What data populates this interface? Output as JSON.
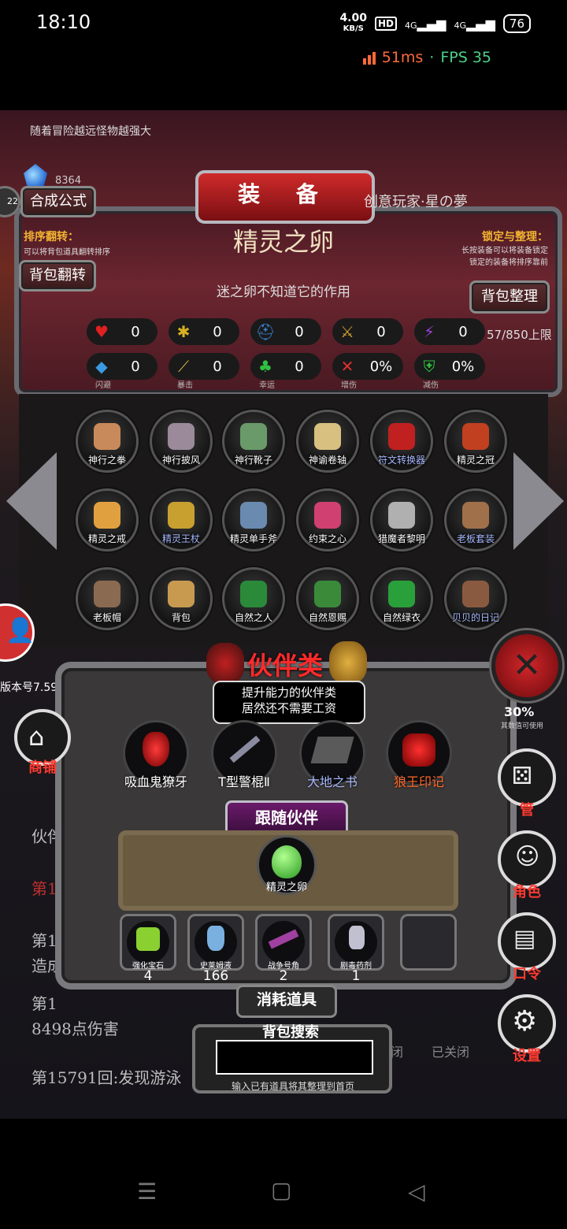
{
  "status": {
    "time": "18:10",
    "net_speed": "4.00",
    "net_unit": "KB/S",
    "hd": "HD",
    "sig1": "4G",
    "sig2": "4G",
    "battery": "76",
    "ping": "51ms",
    "fps": "FPS 35",
    "sep": "·"
  },
  "game": {
    "tip": "随着冒险越远怪物越强大",
    "gem_count": "8364",
    "left_badge": "22",
    "craft_button": "合成公式",
    "title": "装 备",
    "player": "创意玩家·星の夢",
    "sort_flip_label": "排序翻转：",
    "sort_flip_sub": "可以将背包道具翻转排序",
    "flip_button": "背包翻转",
    "lock_label": "锁定与整理：",
    "lock_sub1": "长按装备可以将装备锁定",
    "lock_sub2": "锁定的装备将排序靠前",
    "tidy_button": "背包整理",
    "item_name": "精灵之卵",
    "item_desc": "迷之卵不知道它的作用",
    "capacity": "57/850上限",
    "stats": [
      {
        "icon": "heart-icon",
        "value": "0",
        "label": ""
      },
      {
        "icon": "strength-icon",
        "value": "0",
        "label": ""
      },
      {
        "icon": "helmet-icon",
        "value": "0",
        "label": ""
      },
      {
        "icon": "sword-icon",
        "value": "0",
        "label": ""
      },
      {
        "icon": "lightning-icon",
        "value": "0",
        "label": ""
      },
      {
        "icon": "evade-icon",
        "value": "0",
        "label": "闪避"
      },
      {
        "icon": "crit-icon",
        "value": "0",
        "label": "暴击"
      },
      {
        "icon": "clover-icon",
        "value": "0",
        "label": "幸运"
      },
      {
        "icon": "damage-up-icon",
        "value": "0%",
        "label": "增伤"
      },
      {
        "icon": "damage-down-icon",
        "value": "0%",
        "label": "减伤"
      }
    ],
    "items": [
      {
        "name": "神行之拳",
        "color": "#fff",
        "art": "#c88a5a"
      },
      {
        "name": "神行披风",
        "color": "#fff",
        "art": "#9a8a9a"
      },
      {
        "name": "神行靴子",
        "color": "#fff",
        "art": "#6a9a6a"
      },
      {
        "name": "神谕卷轴",
        "color": "#fff",
        "art": "#d8c080"
      },
      {
        "name": "符文转换器",
        "color": "#a8b8ff",
        "art": "#c02020"
      },
      {
        "name": "精灵之冠",
        "color": "#fff",
        "art": "#c04020"
      },
      {
        "name": "精灵之戒",
        "color": "#fff",
        "art": "#e0a040"
      },
      {
        "name": "精灵王杖",
        "color": "#a8b8ff",
        "art": "#c8a030"
      },
      {
        "name": "精灵单手斧",
        "color": "#fff",
        "art": "#6a8ab0"
      },
      {
        "name": "约束之心",
        "color": "#fff",
        "art": "#d04070"
      },
      {
        "name": "猎魔者黎明",
        "color": "#fff",
        "art": "#b0b0b0"
      },
      {
        "name": "老板套装",
        "color": "#a8b8ff",
        "art": "#a0704a"
      },
      {
        "name": "老板帽",
        "color": "#fff",
        "art": "#8a6a50"
      },
      {
        "name": "背包",
        "color": "#fff",
        "art": "#c89a50"
      },
      {
        "name": "自然之人",
        "color": "#fff",
        "art": "#2a8a3a"
      },
      {
        "name": "自然恩赐",
        "color": "#fff",
        "art": "#3a8a3a"
      },
      {
        "name": "自然绿衣",
        "color": "#fff",
        "art": "#2aa03a"
      },
      {
        "name": "贝贝的日记",
        "color": "#a8b8ff",
        "art": "#8a5a40"
      }
    ],
    "version": "版本号7.59",
    "partner_title": "伙伴类",
    "partner_sub1": "提升能力的伙伴类",
    "partner_sub2": "居然还不需要工资",
    "partners": [
      {
        "name": "吸血鬼獠牙",
        "color": "#fff"
      },
      {
        "name": "T型警棍Ⅱ",
        "color": "#fff"
      },
      {
        "name": "大地之书",
        "color": "#a8b8ff"
      },
      {
        "name": "狼王印记",
        "color": "#ff6a2a"
      }
    ],
    "follow_label": "跟随伙伴",
    "follow_item": "精灵之卵",
    "consumables": [
      {
        "name": "强化宝石",
        "count": "4"
      },
      {
        "name": "史莱姆液",
        "count": "166"
      },
      {
        "name": "战争号角",
        "count": "2"
      },
      {
        "name": "剧毒药剂",
        "count": "1"
      },
      {
        "name": "",
        "count": ""
      }
    ],
    "consumables_label": "消耗道具",
    "search_label": "背包搜索",
    "search_hint": "输入已有道具将其整理到首页",
    "search_value": "",
    "bg_log": [
      "伙伴",
      "第1",
      "第15",
      "造成",
      "第1",
      "8498点伤害",
      "第15791回:发现游泳"
    ],
    "right_nav": [
      {
        "name": "shop",
        "label": "商铺"
      },
      {
        "name": "manage",
        "label": "管"
      },
      {
        "name": "role",
        "label": "角色"
      },
      {
        "name": "code",
        "label": "口令"
      },
      {
        "name": "settings",
        "label": "设置"
      }
    ],
    "rate_text": "30%",
    "rate_sub": "其数值可使用",
    "closed1": "闭",
    "closed2": "已关闭"
  },
  "navbar": {
    "menu": "☰",
    "home": "▢",
    "back": "◁"
  }
}
